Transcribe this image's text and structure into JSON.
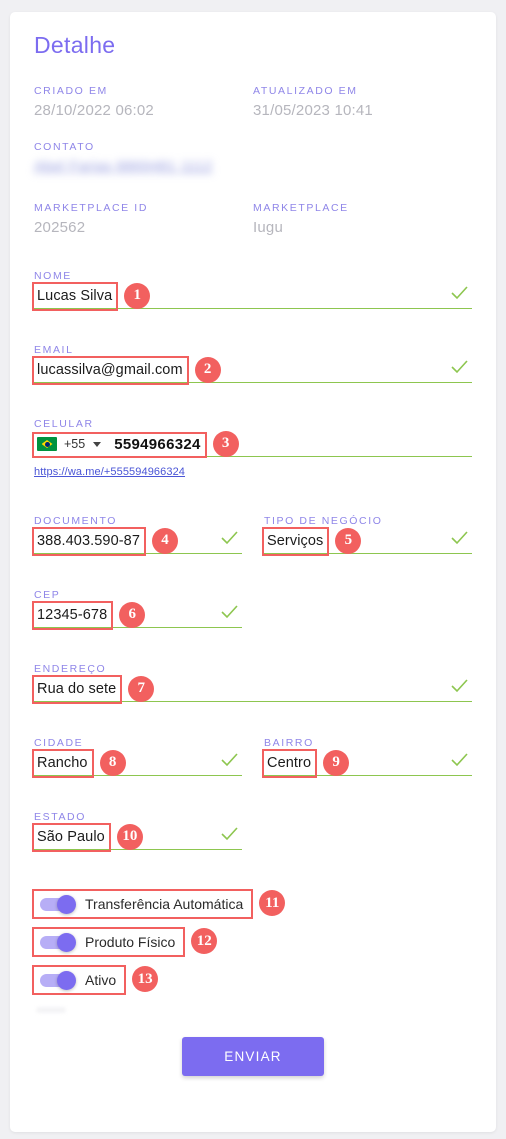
{
  "card": {
    "title": "Detalhe"
  },
  "meta": {
    "created": {
      "label": "CRIADO EM",
      "value": "28/10/2022 06:02"
    },
    "updated": {
      "label": "ATUALIZADO EM",
      "value": "31/05/2023 10:41"
    },
    "contato": {
      "label": "CONTATO",
      "value": "Abel Farias  8869481 1112"
    },
    "marketplace_id": {
      "label": "MARKETPLACE ID",
      "value": "202562"
    },
    "marketplace": {
      "label": "MARKETPLACE",
      "value": "Iugu"
    }
  },
  "fields": {
    "nome": {
      "label": "NOME",
      "value": "Lucas Silva",
      "badge": "1"
    },
    "email": {
      "label": "EMAIL",
      "value": "lucassilva@gmail.com",
      "badge": "2"
    },
    "celular": {
      "label": "CELULAR",
      "dial_code": "+55",
      "value": "5594966324",
      "badge": "3",
      "whatsapp_link": "https://wa.me/+555594966324"
    },
    "documento": {
      "label": "DOCUMENTO",
      "value": "388.403.590-87",
      "badge": "4"
    },
    "tipo_negocio": {
      "label": "TIPO DE NEGÓCIO",
      "value": "Serviços",
      "badge": "5"
    },
    "cep": {
      "label": "CEP",
      "value": "12345-678",
      "badge": "6"
    },
    "endereco": {
      "label": "ENDEREÇO",
      "value": "Rua do sete",
      "badge": "7"
    },
    "cidade": {
      "label": "CIDADE",
      "value": "Rancho",
      "badge": "8"
    },
    "bairro": {
      "label": "BAIRRO",
      "value": "Centro",
      "badge": "9"
    },
    "estado": {
      "label": "ESTADO",
      "value": "São Paulo",
      "badge": "10"
    }
  },
  "toggles": [
    {
      "label": "Transferência Automática",
      "badge": "11",
      "on": true
    },
    {
      "label": "Produto Físico",
      "badge": "12",
      "on": true
    },
    {
      "label": "Ativo",
      "badge": "13",
      "on": true
    }
  ],
  "submit": {
    "label": "ENVIAR"
  },
  "colors": {
    "accent_purple": "#7c6cf0",
    "label_purple": "#8f86e8",
    "valid_green": "#8dc64f",
    "annotation_red": "#f2605f",
    "page_bg": "#f0f0f3",
    "card_bg": "#ffffff",
    "muted_text": "#b6b6bd",
    "link_blue": "#4a55d6"
  }
}
